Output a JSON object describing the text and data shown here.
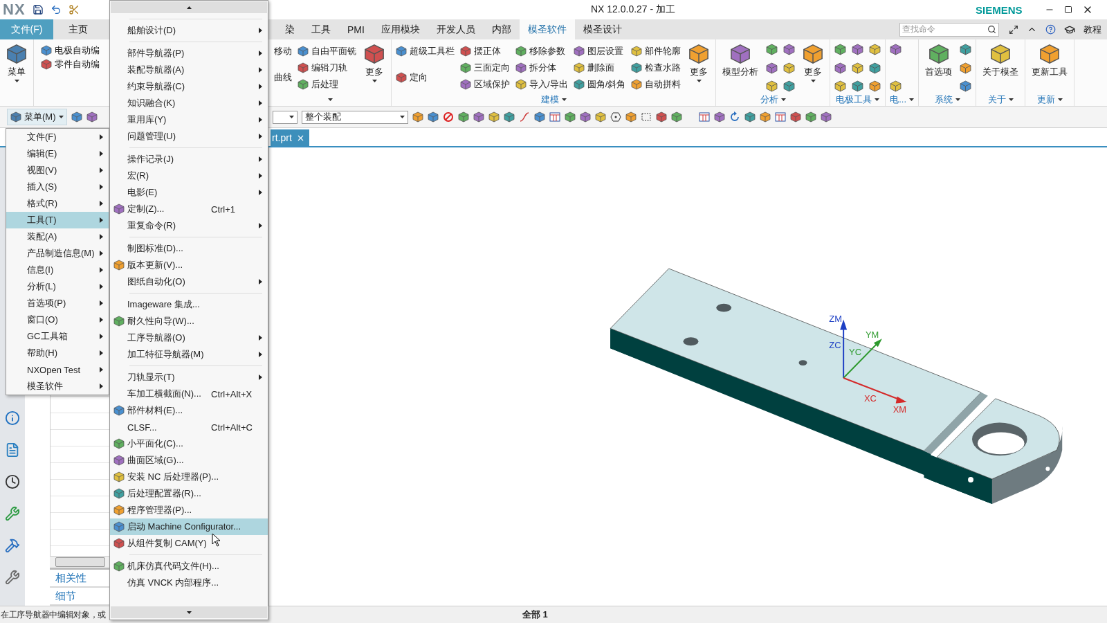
{
  "title_bar": {
    "logo": "NX",
    "title": "NX 12.0.0.27 - 加工",
    "brand": "SIEMENS"
  },
  "file_tab": {
    "label": "文件(F)"
  },
  "ribbon_tabs_left": [
    {
      "label": "主页",
      "selected": false
    }
  ],
  "ribbon_tabs_right": [
    {
      "label": "染",
      "selected": false
    },
    {
      "label": "工具",
      "selected": false
    },
    {
      "label": "PMI",
      "selected": false
    },
    {
      "label": "应用模块",
      "selected": false
    },
    {
      "label": "开发人员",
      "selected": false
    },
    {
      "label": "内部",
      "selected": false
    },
    {
      "label": "模圣软件",
      "selected": true
    },
    {
      "label": "模圣设计",
      "selected": false
    }
  ],
  "command_search": {
    "placeholder": "查找命令"
  },
  "tutorial_label": "教程",
  "ribbon_menu_button": {
    "label": "菜单",
    "caret": true
  },
  "ribbon_left_entries": [
    {
      "label": "电极自动编",
      "icon": true
    },
    {
      "label": "零件自动编",
      "icon": true
    }
  ],
  "ribbon_groups": [
    {
      "items": [
        {
          "kind": "column",
          "entries": [
            {
              "label": "移动",
              "icon": false
            },
            {
              "label": "曲线",
              "icon": false
            }
          ]
        },
        {
          "kind": "column",
          "entries": [
            {
              "label": "自由平面铣",
              "icon": true
            },
            {
              "label": "编辑刀轨",
              "icon": true
            },
            {
              "label": "后处理",
              "icon": true
            }
          ]
        },
        {
          "kind": "big",
          "label": "更多",
          "caret": true
        }
      ]
    },
    {
      "label": "建模",
      "items": [
        {
          "kind": "column",
          "entries": [
            {
              "label": "超级工具栏",
              "icon": true
            },
            {
              "label": "定向",
              "icon": true
            }
          ]
        },
        {
          "kind": "column",
          "entries": [
            {
              "label": "摆正体",
              "icon": true
            },
            {
              "label": "三面定向",
              "icon": true
            },
            {
              "label": "区域保护",
              "icon": true
            }
          ]
        },
        {
          "kind": "column",
          "entries": [
            {
              "label": "移除参数",
              "icon": true
            },
            {
              "label": "拆分体",
              "icon": true
            },
            {
              "label": "导入/导出",
              "icon": true
            }
          ]
        },
        {
          "kind": "column",
          "entries": [
            {
              "label": "图层设置",
              "icon": true
            },
            {
              "label": "删除面",
              "icon": true
            },
            {
              "label": "圆角/斜角",
              "icon": true
            }
          ]
        },
        {
          "kind": "column",
          "entries": [
            {
              "label": "部件轮廓",
              "icon": true
            },
            {
              "label": "检查水路",
              "icon": true
            },
            {
              "label": "自动拼料",
              "icon": true
            }
          ]
        },
        {
          "kind": "big",
          "label": "更多",
          "caret": true
        }
      ]
    },
    {
      "label": "分析",
      "items": [
        {
          "kind": "big",
          "label": "模型分析",
          "caret": false
        },
        {
          "kind": "icons3"
        },
        {
          "kind": "icons3"
        },
        {
          "kind": "big",
          "label": "更多",
          "caret": true
        }
      ]
    },
    {
      "label": "电极工具",
      "items": [
        {
          "kind": "icons3"
        },
        {
          "kind": "icons3"
        },
        {
          "kind": "icons3"
        }
      ]
    },
    {
      "label": "电...",
      "items": [
        {
          "kind": "icons2"
        }
      ]
    },
    {
      "label": "系统",
      "items": [
        {
          "kind": "big",
          "label": "首选项",
          "caret": false
        },
        {
          "kind": "icons3"
        }
      ]
    },
    {
      "label": "关于",
      "items": [
        {
          "kind": "big",
          "label": "关于模圣",
          "caret": false
        }
      ]
    },
    {
      "label": "更新",
      "items": [
        {
          "kind": "big",
          "label": "更新工具",
          "caret": false
        }
      ]
    }
  ],
  "toolbar": {
    "menu_button": "菜单(M)",
    "assembly_select": "整个装配"
  },
  "document_tab": {
    "label": "rt.prt",
    "selected": true
  },
  "navigator": {
    "sections": [
      "相关性",
      "细节"
    ]
  },
  "main_menu": [
    {
      "label": "文件(F)",
      "selected": false
    },
    {
      "label": "编辑(E)",
      "selected": false
    },
    {
      "label": "视图(V)",
      "selected": false
    },
    {
      "label": "插入(S)",
      "selected": false
    },
    {
      "label": "格式(R)",
      "selected": false
    },
    {
      "label": "工具(T)",
      "selected": true
    },
    {
      "label": "装配(A)",
      "selected": false
    },
    {
      "label": "产品制造信息(M)",
      "selected": false
    },
    {
      "label": "信息(I)",
      "selected": false
    },
    {
      "label": "分析(L)",
      "selected": false
    },
    {
      "label": "首选项(P)",
      "selected": false
    },
    {
      "label": "窗口(O)",
      "selected": false
    },
    {
      "label": "GC工具箱",
      "selected": false
    },
    {
      "label": "帮助(H)",
      "selected": false
    },
    {
      "label": "NXOpen Test",
      "selected": false
    },
    {
      "label": "模圣软件",
      "selected": false
    }
  ],
  "tools_menu": [
    {
      "items": [
        {
          "label": "船舶设计(D)",
          "submenu": true,
          "icon": false,
          "selected": false
        }
      ]
    },
    {
      "items": [
        {
          "label": "部件导航器(P)",
          "submenu": true,
          "icon": false,
          "selected": false
        },
        {
          "label": "装配导航器(A)",
          "submenu": true,
          "icon": false,
          "selected": false
        },
        {
          "label": "约束导航器(C)",
          "submenu": true,
          "icon": false,
          "selected": false
        },
        {
          "label": "知识融合(K)",
          "submenu": true,
          "icon": false,
          "selected": false
        },
        {
          "label": "重用库(Y)",
          "submenu": true,
          "icon": false,
          "selected": false
        },
        {
          "label": "问题管理(U)",
          "submenu": true,
          "icon": false,
          "selected": false
        }
      ]
    },
    {
      "items": [
        {
          "label": "操作记录(J)",
          "submenu": true,
          "icon": false,
          "selected": false
        },
        {
          "label": "宏(R)",
          "submenu": true,
          "icon": false,
          "selected": false
        },
        {
          "label": "电影(E)",
          "submenu": true,
          "icon": false,
          "selected": false
        },
        {
          "label": "定制(Z)...",
          "shortcut": "Ctrl+1",
          "submenu": false,
          "icon": true,
          "selected": false
        },
        {
          "label": "重复命令(R)",
          "submenu": true,
          "icon": false,
          "selected": false
        }
      ]
    },
    {
      "items": [
        {
          "label": "制图标准(D)...",
          "submenu": false,
          "icon": false,
          "selected": false
        },
        {
          "label": "版本更新(V)...",
          "submenu": false,
          "icon": true,
          "selected": false
        },
        {
          "label": "图纸自动化(O)",
          "submenu": true,
          "icon": false,
          "selected": false
        }
      ]
    },
    {
      "items": [
        {
          "label": "Imageware 集成...",
          "submenu": false,
          "icon": false,
          "selected": false
        },
        {
          "label": "耐久性向导(W)...",
          "submenu": false,
          "icon": true,
          "selected": false
        },
        {
          "label": "工序导航器(O)",
          "submenu": true,
          "icon": false,
          "selected": false
        },
        {
          "label": "加工特征导航器(M)",
          "submenu": true,
          "icon": false,
          "selected": false
        }
      ]
    },
    {
      "items": [
        {
          "label": "刀轨显示(T)",
          "submenu": true,
          "icon": false,
          "selected": false
        },
        {
          "label": "车加工横截面(N)...",
          "shortcut": "Ctrl+Alt+X",
          "submenu": false,
          "icon": false,
          "selected": false
        },
        {
          "label": "部件材料(E)...",
          "submenu": false,
          "icon": true,
          "selected": false
        },
        {
          "label": "CLSF...",
          "shortcut": "Ctrl+Alt+C",
          "submenu": false,
          "icon": false,
          "selected": false
        },
        {
          "label": "小平面化(C)...",
          "submenu": false,
          "icon": true,
          "selected": false
        },
        {
          "label": "曲面区域(G)...",
          "submenu": false,
          "icon": true,
          "selected": false
        },
        {
          "label": "安装 NC 后处理器(P)...",
          "submenu": false,
          "icon": true,
          "selected": false
        },
        {
          "label": "后处理配置器(R)...",
          "submenu": false,
          "icon": true,
          "selected": false
        },
        {
          "label": "程序管理器(P)...",
          "submenu": false,
          "icon": true,
          "selected": false
        },
        {
          "label": "启动 Machine Configurator...",
          "submenu": false,
          "icon": true,
          "selected": true
        },
        {
          "label": "从组件复制 CAM(Y)",
          "submenu": false,
          "icon": true,
          "selected": false
        }
      ]
    },
    {
      "items": [
        {
          "label": "机床仿真代码文件(H)...",
          "submenu": false,
          "icon": true,
          "selected": false
        },
        {
          "label": "仿真 VNCK 内部程序...",
          "submenu": false,
          "icon": false,
          "selected": false
        }
      ]
    }
  ],
  "viewport": {
    "axis_labels": [
      {
        "label": "ZM",
        "color": "#1d3fc4"
      },
      {
        "label": "ZC",
        "color": "#1d3fc4"
      },
      {
        "label": "YM",
        "color": "#2e9a2e"
      },
      {
        "label": "YC",
        "color": "#2e9a2e"
      },
      {
        "label": "XC",
        "color": "#d42a2a"
      },
      {
        "label": "XM",
        "color": "#d42a2a"
      }
    ]
  },
  "status_bar": {
    "message": "在工序导航器中编辑对象，或",
    "selection": "全部 1"
  }
}
